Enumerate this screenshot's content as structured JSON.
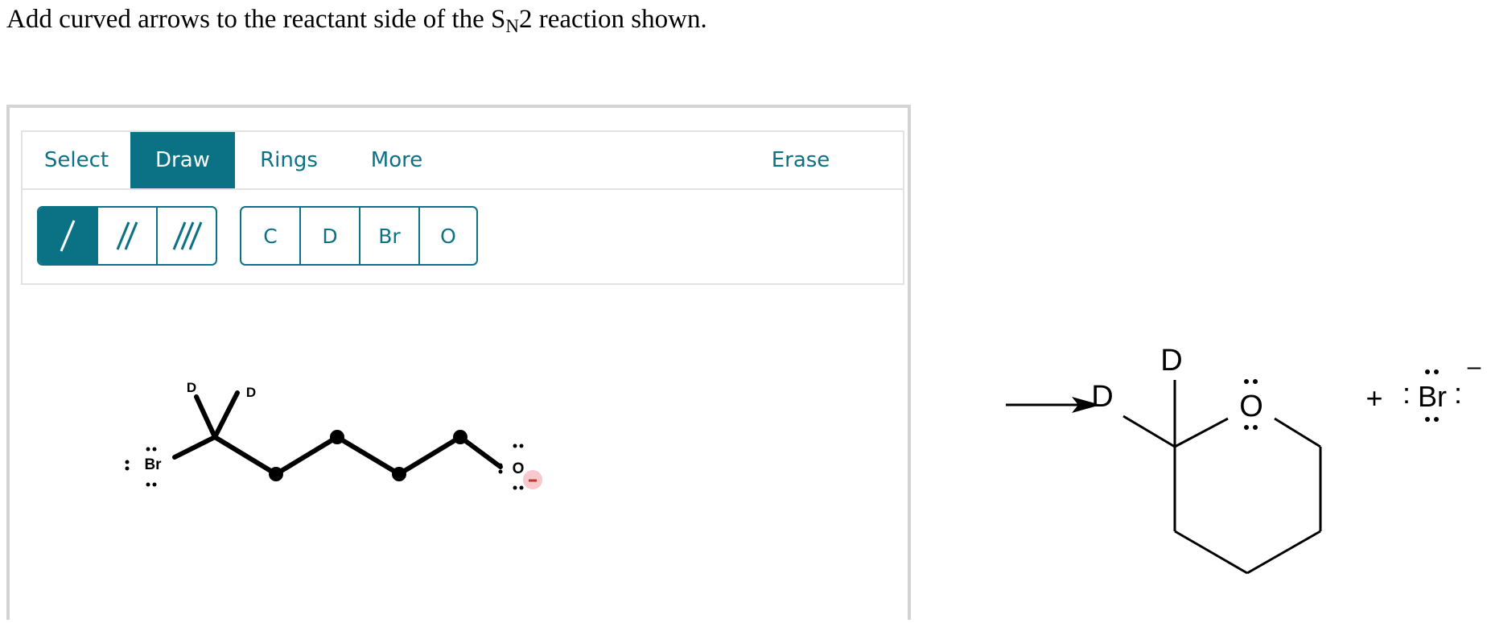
{
  "question": {
    "text_before": "Add curved arrows to the reactant side of the S",
    "subscript": "N",
    "text_after": "2 reaction shown."
  },
  "toolbar": {
    "tabs": [
      {
        "label": "Select",
        "active": false
      },
      {
        "label": "Draw",
        "active": true
      },
      {
        "label": "Rings",
        "active": false
      },
      {
        "label": "More",
        "active": false
      },
      {
        "label": "Erase",
        "active": false
      }
    ],
    "bond_buttons": [
      "single-bond",
      "double-bond",
      "triple-bond"
    ],
    "atom_buttons": [
      "C",
      "D",
      "Br",
      "O"
    ]
  },
  "reactant": {
    "atoms": {
      "d1": "D",
      "d2": "D",
      "br": "Br",
      "o": "O"
    },
    "lone_pair": ":",
    "charge": "–"
  },
  "product": {
    "atoms": {
      "d_top": "D",
      "d_left": "D",
      "o": "O"
    },
    "plus": "+",
    "bromide": "Br",
    "charge": "–",
    "lone_pair": ":"
  },
  "colors": {
    "accent": "#0b7285",
    "charge_bg": "#f8c8cc",
    "border": "#d3d3d3"
  }
}
